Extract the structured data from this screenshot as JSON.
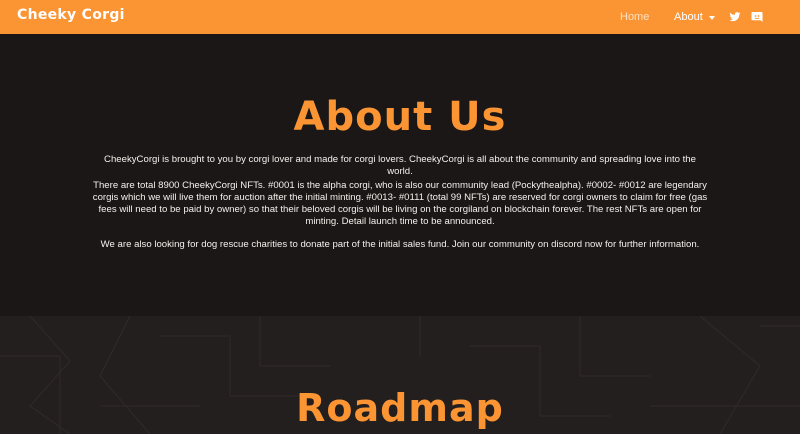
{
  "navbar": {
    "brand": "Cheeky Corgi",
    "links": [
      {
        "label": "Home"
      },
      {
        "label": "About"
      }
    ],
    "social": [
      "twitter-icon",
      "discord-icon"
    ],
    "colors": {
      "background": "#fb9433",
      "text": "#ffffff",
      "muted": "#fde1c2"
    }
  },
  "about": {
    "title": "About Us",
    "paragraphs": [
      "CheekyCorgi is brought to you by corgi lover and made for corgi lovers. CheekyCorgi is all about the community and spreading love into the world.",
      "There are total 8900 CheekyCorgi NFTs. #0001 is the alpha corgi, who is also our community lead (Pockythealpha). #0002- #0012 are legendary corgis which we will live them for auction after the initial minting. #0013- #0111 (total 99 NFTs) are reserved for corgi owners to claim for free (gas fees will need to be paid by owner) so that their beloved corgis will be living on the corgiland on blockchain forever. The rest NFTs are open for minting. Detail launch time to be announced.",
      "We are also looking for dog rescue charities to donate part of the initial sales fund. Join our community on discord now for further information."
    ],
    "colors": {
      "title": "#fb9433",
      "background": "#1a1716"
    }
  },
  "roadmap": {
    "title": "Roadmap",
    "colors": {
      "background": "#231f1e"
    }
  }
}
